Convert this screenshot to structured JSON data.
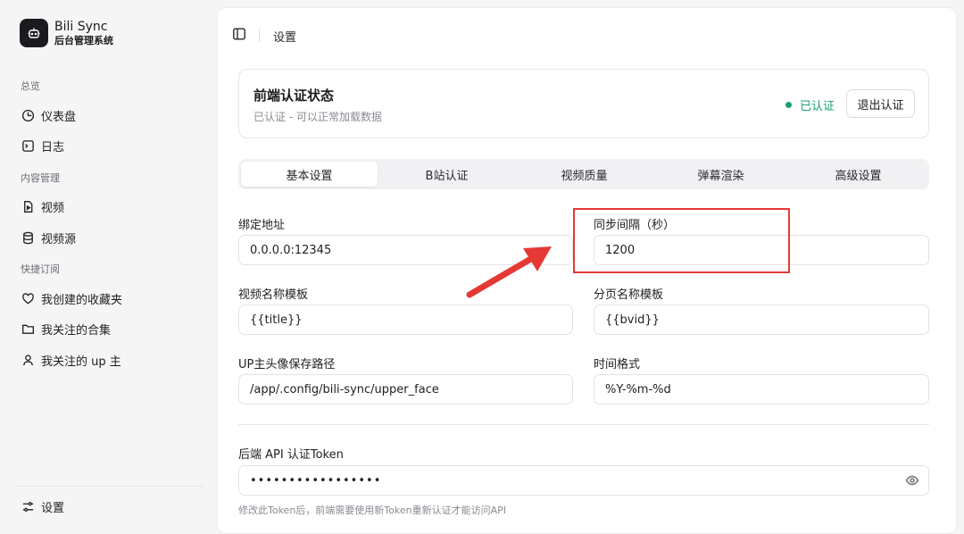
{
  "brand": {
    "name": "Bili Sync",
    "subtitle": "后台管理系统"
  },
  "sidebar": {
    "groups": [
      {
        "label": "总览",
        "items": [
          {
            "label": "仪表盘",
            "icon": "gauge-icon"
          },
          {
            "label": "日志",
            "icon": "terminal-icon"
          }
        ]
      },
      {
        "label": "内容管理",
        "items": [
          {
            "label": "视频",
            "icon": "video-file-icon"
          },
          {
            "label": "视频源",
            "icon": "database-icon"
          }
        ]
      },
      {
        "label": "快捷订阅",
        "items": [
          {
            "label": "我创建的收藏夹",
            "icon": "heart-icon"
          },
          {
            "label": "我关注的合集",
            "icon": "folder-icon"
          },
          {
            "label": "我关注的 up 主",
            "icon": "user-icon"
          }
        ]
      }
    ],
    "footer": {
      "label": "设置",
      "icon": "sliders-icon"
    }
  },
  "topbar": {
    "breadcrumb": "设置"
  },
  "auth": {
    "title": "前端认证状态",
    "description": "已认证 - 可以正常加载数据",
    "status": "已认证",
    "logout_label": "退出认证",
    "status_color": "#1aa06d"
  },
  "tabs": [
    {
      "label": "基本设置",
      "active": true
    },
    {
      "label": "B站认证",
      "active": false
    },
    {
      "label": "视频质量",
      "active": false
    },
    {
      "label": "弹幕渲染",
      "active": false
    },
    {
      "label": "高级设置",
      "active": false
    }
  ],
  "form": {
    "bind_address": {
      "label": "绑定地址",
      "value": "0.0.0.0:12345"
    },
    "sync_interval": {
      "label": "同步间隔（秒）",
      "value": "1200"
    },
    "video_name_template": {
      "label": "视频名称模板",
      "value": "{{title}}"
    },
    "page_name_template": {
      "label": "分页名称模板",
      "value": "{{bvid}}"
    },
    "upper_path": {
      "label": "UP主头像保存路径",
      "value": "/app/.config/bili-sync/upper_face"
    },
    "time_format": {
      "label": "时间格式",
      "value": "%Y-%m-%d"
    },
    "api_token": {
      "label": "后端 API 认证Token",
      "value": "•••••••••••••••••"
    },
    "token_hint": "修改此Token后，前端需要使用新Token重新认证才能访问API"
  },
  "annotation": {
    "color": "#e53935"
  }
}
